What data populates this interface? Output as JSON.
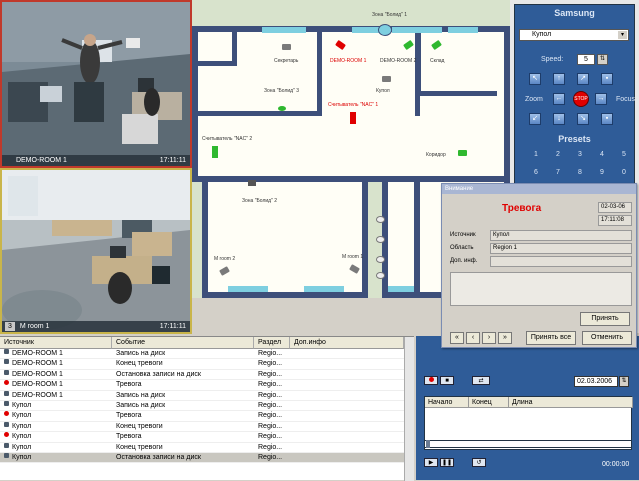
{
  "cameras": [
    {
      "number": "",
      "name": "DEMO-ROOM 1",
      "time": "17:11:11"
    },
    {
      "number": "3",
      "name": "M room 1",
      "time": "17:11:11"
    }
  ],
  "plan": {
    "labels": [
      {
        "text": "Зона \"Болид\" 1",
        "red": false
      },
      {
        "text": "Секретарь",
        "red": false
      },
      {
        "text": "DEMO-ROOM 1",
        "red": true
      },
      {
        "text": "DEMO-ROOM 2",
        "red": false
      },
      {
        "text": "Склад",
        "red": false
      },
      {
        "text": "Зона \"Болид\" 3",
        "red": false
      },
      {
        "text": "Купол",
        "red": false
      },
      {
        "text": "Считыватель \"NAC\" 1",
        "red": true
      },
      {
        "text": "Считыватель \"NAC\" 2",
        "red": false
      },
      {
        "text": "Коридор",
        "red": false
      },
      {
        "text": "Зона \"Болид\" 2",
        "red": false
      },
      {
        "text": "M room 2",
        "red": false
      },
      {
        "text": "M room 1",
        "red": false
      }
    ]
  },
  "ptz": {
    "title": "Samsung",
    "camera": "Купол",
    "speed_label": "Speed:",
    "speed_value": "5",
    "zoom_label": "Zoom",
    "focus_label": "Focus",
    "stop_label": "STOP",
    "presets_label": "Presets",
    "presets": [
      "1",
      "2",
      "3",
      "4",
      "5",
      "6",
      "7",
      "8",
      "9",
      "0"
    ]
  },
  "events": {
    "columns": [
      "Источник",
      "Событие",
      "Раздел",
      "Доп.инфо"
    ],
    "rows": [
      {
        "source": "DEMO-ROOM 1",
        "event": "Запись на диск",
        "section": "Regio...",
        "alarm": false
      },
      {
        "source": "DEMO-ROOM 1",
        "event": "Конец тревоги",
        "section": "Regio...",
        "alarm": false
      },
      {
        "source": "DEMO-ROOM 1",
        "event": "Остановка записи на диск",
        "section": "Regio...",
        "alarm": false
      },
      {
        "source": "DEMO-ROOM 1",
        "event": "Тревога",
        "section": "Regio...",
        "alarm": true
      },
      {
        "source": "DEMO-ROOM 1",
        "event": "Запись на диск",
        "section": "Regio...",
        "alarm": false
      },
      {
        "source": "Купол",
        "event": "Запись на диск",
        "section": "Regio...",
        "alarm": false
      },
      {
        "source": "Купол",
        "event": "Тревога",
        "section": "Regio...",
        "alarm": true
      },
      {
        "source": "Купол",
        "event": "Конец тревоги",
        "section": "Regio...",
        "alarm": false
      },
      {
        "source": "Купол",
        "event": "Тревога",
        "section": "Regio...",
        "alarm": true
      },
      {
        "source": "Купол",
        "event": "Конец тревоги",
        "section": "Regio...",
        "alarm": false
      },
      {
        "source": "Купол",
        "event": "Остановка записи на диск",
        "section": "Regio...",
        "alarm": false
      }
    ]
  },
  "playback": {
    "date": "02.03.2006",
    "columns": [
      "Начало",
      "Конец",
      "Длина"
    ],
    "time": "00:00:00"
  },
  "alarm_dialog": {
    "title": "Внимание",
    "heading": "Тревога",
    "date": "02-03-06",
    "time": "17:11:08",
    "source_label": "Источник",
    "source_value": "Купол",
    "area_label": "Область",
    "area_value": "Region 1",
    "info_label": "Доп. инф.",
    "info_value": "",
    "accept_label": "Принять",
    "accept_all_label": "Принять все",
    "cancel_label": "Отменить",
    "nav": [
      "«",
      "‹",
      "›",
      "»"
    ]
  },
  "colors": {
    "alarm_red": "#e00000",
    "panel_blue": "#2f5c98"
  }
}
